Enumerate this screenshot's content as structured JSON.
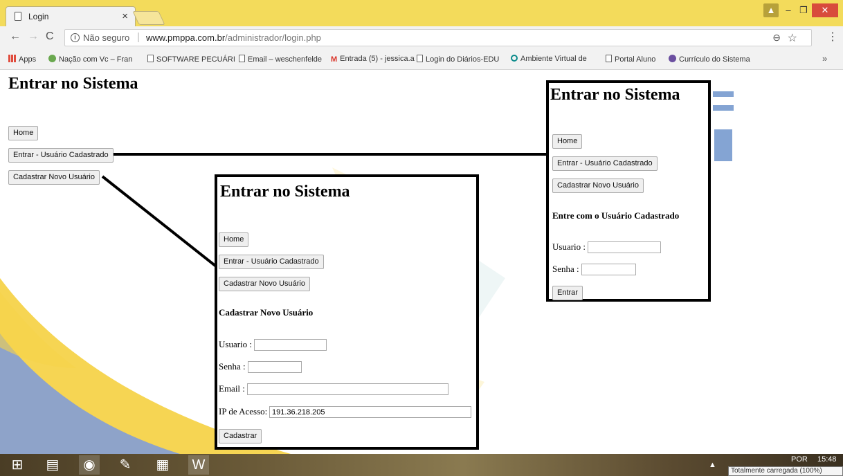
{
  "browser": {
    "tab_title": "Login",
    "tab_close": "×",
    "secure_label": "Não seguro",
    "url_host": "www.pmppa.com.br",
    "url_path": "/administrador/login.php",
    "window_controls": {
      "minimize": "–",
      "maximize": "❐",
      "close": "✕",
      "user": "👤"
    }
  },
  "bookmarks": [
    {
      "label": "Apps",
      "icon": "apps-icon"
    },
    {
      "label": "Nação com Vc – Fran",
      "icon": "green-icon"
    },
    {
      "label": "SOFTWARE PECUÁRI",
      "icon": "page-icon"
    },
    {
      "label": "Email – weschenfelde",
      "icon": "page-icon"
    },
    {
      "label": "Entrada (5) - jessica.a",
      "icon": "gmail-icon"
    },
    {
      "label": "Login do Diários-EDU",
      "icon": "page-icon"
    },
    {
      "label": "Ambiente Virtual de",
      "icon": "teal-icon"
    },
    {
      "label": "Portal Aluno",
      "icon": "page-icon"
    },
    {
      "label": "Currículo do Sistema",
      "icon": "globe-icon"
    }
  ],
  "bookmarks_more": "»",
  "page": {
    "title": "Entrar no Sistema",
    "buttons": {
      "home": "Home",
      "login_registered": "Entrar - Usuário Cadastrado",
      "register_new": "Cadastrar Novo Usuário"
    }
  },
  "callout_register": {
    "title": "Entrar no Sistema",
    "buttons": {
      "home": "Home",
      "login_registered": "Entrar - Usuário Cadastrado",
      "register_new": "Cadastrar Novo Usuário"
    },
    "section_heading": "Cadastrar Novo Usuário",
    "usuario_label": "Usuario :",
    "usuario_value": "",
    "senha_label": "Senha :",
    "senha_value": "",
    "email_label": "Email :",
    "email_value": "",
    "ip_label": "IP de Acesso:",
    "ip_value": "191.36.218.205",
    "submit": "Cadastrar"
  },
  "callout_login": {
    "title": "Entrar no Sistema",
    "buttons": {
      "home": "Home",
      "login_registered": "Entrar - Usuário Cadastrado",
      "register_new": "Cadastrar Novo Usuário"
    },
    "section_heading": "Entre com o Usuário Cadastrado",
    "usuario_label": "Usuario :",
    "usuario_value": "",
    "senha_label": "Senha :",
    "senha_value": "",
    "submit": "Entrar"
  },
  "taskbar": {
    "language": "POR",
    "time": "15:48",
    "tooltip": "Totalmente carregada (100%)"
  },
  "colors": {
    "titlebar": "#f3db5b",
    "chrome_bg": "#f2f2f2",
    "art_yellow": "#f6d34a",
    "art_blue": "#5b86c4",
    "art_gray_blue": "#8ea3c9"
  }
}
